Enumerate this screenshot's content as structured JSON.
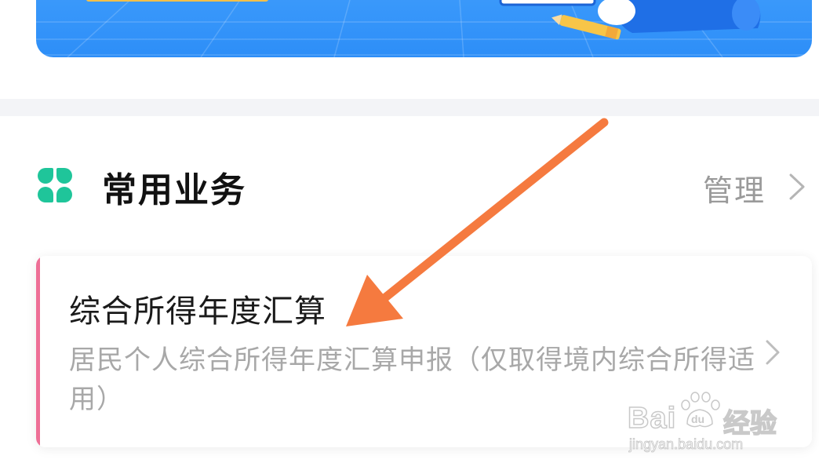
{
  "banner": {
    "colors": {
      "background": "#2d8ef8",
      "pencil": "#f7c548"
    }
  },
  "section": {
    "icon": "clover-grid-icon",
    "icon_color": "#1fc59a",
    "title": "常用业务",
    "manage_label": "管理",
    "manage_icon": "chevron-right-icon"
  },
  "card": {
    "accent_color": "#ee6f96",
    "title": "综合所得年度汇算",
    "description": "居民个人综合所得年度汇算申报（仅取得境内综合所得适用）",
    "chevron_icon": "chevron-right-icon"
  },
  "annotation": {
    "icon": "orange-arrow-annotation",
    "color": "#f57a3f"
  },
  "watermark": {
    "brand": "Bai",
    "brand_suffix": "du",
    "cn_text": "经验",
    "url": "jingyan.baidu.com"
  }
}
